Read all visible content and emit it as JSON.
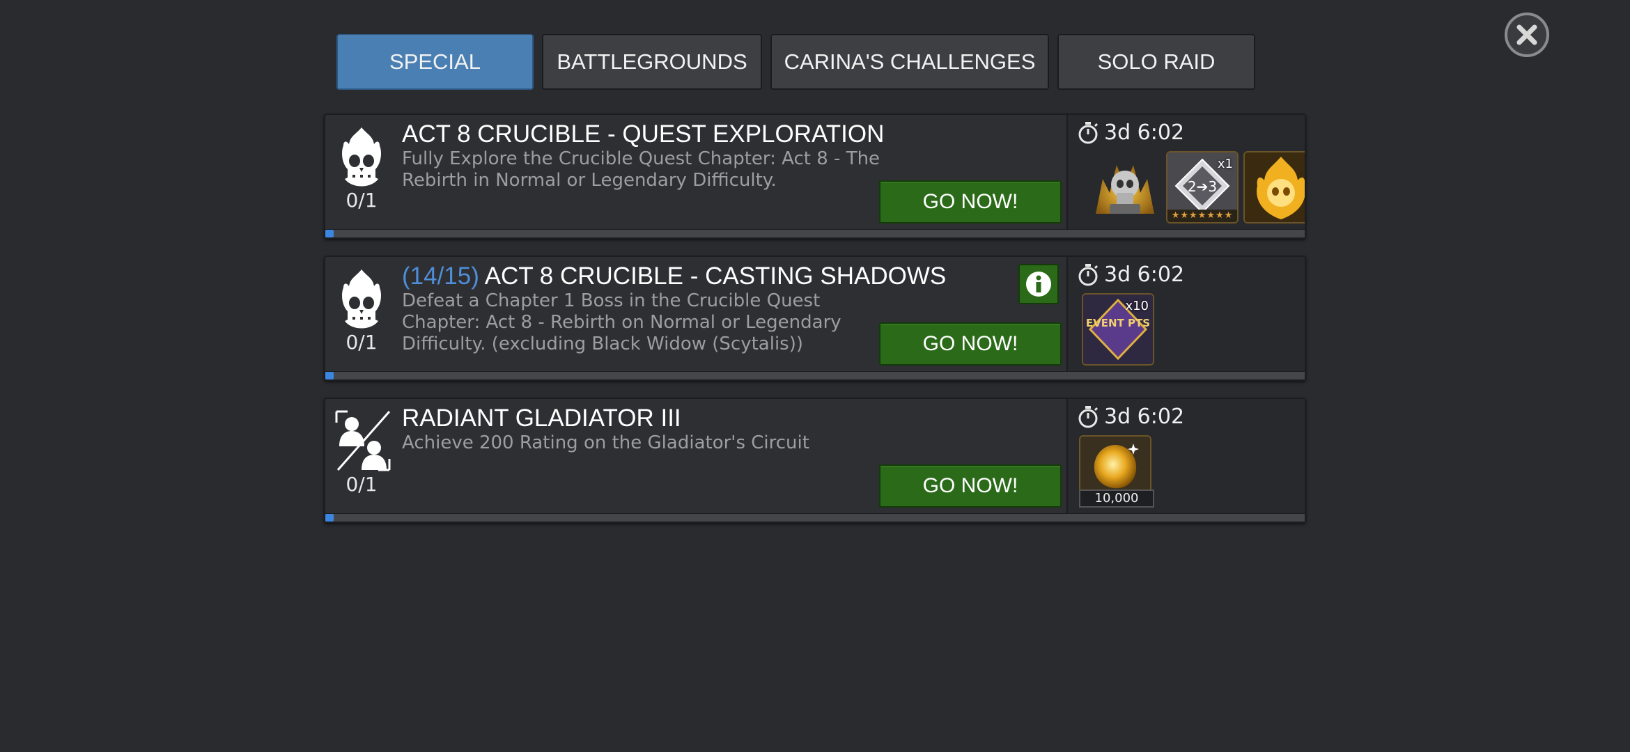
{
  "tabs": [
    {
      "label": "SPECIAL",
      "active": true
    },
    {
      "label": "BATTLEGROUNDS",
      "active": false
    },
    {
      "label": "CARINA'S CHALLENGES",
      "active": false
    },
    {
      "label": "SOLO RAID",
      "active": false
    }
  ],
  "quests": [
    {
      "step": "",
      "title": "ACT 8 CRUCIBLE - QUEST EXPLORATION",
      "description": "Fully Explore the Crucible Quest Chapter: Act 8 - The Rebirth in Normal or Legendary Difficulty.",
      "progress": "0/1",
      "progress_fraction": 0.0,
      "button": "GO NOW!",
      "timer": "3d 6:02",
      "icon": "flaming-skull-icon",
      "rewards": [
        {
          "icon": "golden-skull-crystal-icon",
          "qty": ""
        },
        {
          "icon": "rank-up-gem-2-3-icon",
          "qty": "x1",
          "stars": "★★★★★★★"
        },
        {
          "icon": "flaming-skull-reward-icon",
          "qty": ""
        }
      ]
    },
    {
      "step": "(14/15)",
      "title": "ACT 8 CRUCIBLE - CASTING SHADOWS",
      "description": "Defeat a Chapter 1 Boss in the Crucible Quest Chapter: Act 8 - Rebirth on Normal or Legendary Difficulty. (excluding Black Widow (Scytalis))",
      "progress": "0/1",
      "progress_fraction": 0.0,
      "button": "GO NOW!",
      "timer": "3d 6:02",
      "icon": "flaming-skull-icon",
      "has_info": true,
      "rewards": [
        {
          "icon": "event-pts-icon",
          "qty": "x10",
          "label": "EVENT PTS"
        }
      ]
    },
    {
      "step": "",
      "title": "RADIANT GLADIATOR III",
      "description": "Achieve 200 Rating on the Gladiator's Circuit",
      "progress": "0/1",
      "progress_fraction": 0.0,
      "button": "GO NOW!",
      "timer": "3d 6:02",
      "icon": "gladiator-versus-icon",
      "rewards": [
        {
          "icon": "gold-crystal-shard-icon",
          "amount": "10,000"
        }
      ]
    }
  ],
  "colors": {
    "background": "#2a2b2f",
    "active_tab": "#4a7fb3",
    "go_button": "#2a6a18",
    "progress_fill": "#3b86e0",
    "step_text": "#4f8ed8"
  }
}
